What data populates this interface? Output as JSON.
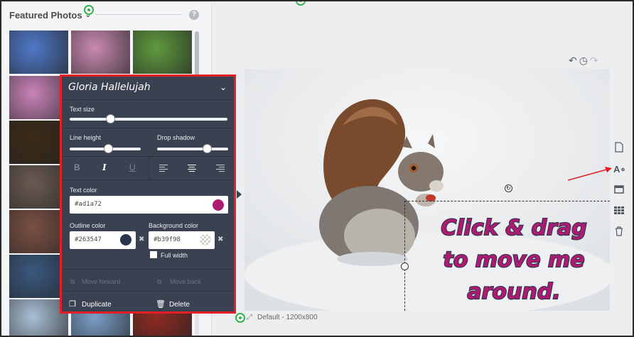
{
  "sidebar": {
    "title": "Featured Photos",
    "help_icon": "?",
    "photos": [
      {
        "name": "blue-hydrangea",
        "color": "#4f79c9"
      },
      {
        "name": "pink-blossoms",
        "color": "#c98ab0"
      },
      {
        "name": "green-grass",
        "color": "#5f9a3e"
      },
      {
        "name": "pink-tree",
        "color": "#c983b9"
      },
      {
        "name": "sparkler",
        "color": "#3b2a16"
      },
      {
        "name": "coffee-cup",
        "color": "#6b5a52"
      },
      {
        "name": "woman-portrait",
        "color": "#7a5043"
      },
      {
        "name": "winter-girl",
        "color": "#39587e"
      },
      {
        "name": "snowy-mountain",
        "color": "#a9bfd6"
      },
      {
        "name": "snow-crystals",
        "color": "#7a9ec8"
      },
      {
        "name": "red-ornaments",
        "color": "#8e2a22"
      }
    ]
  },
  "text_panel": {
    "font_name": "Gloria Hallelujah",
    "text_size_label": "Text size",
    "text_size_value": 0.27,
    "line_height_label": "Line height",
    "line_height_value": 0.55,
    "drop_shadow_label": "Drop shadow",
    "drop_shadow_value": 0.7,
    "format_buttons": [
      "B",
      "I",
      "U"
    ],
    "text_color_label": "Text color",
    "text_color": "#ad1a72",
    "outline_color_label": "Outline color",
    "outline_color": "#263547",
    "background_color_label": "Background color",
    "background_color": "#b39f98",
    "full_width_label": "Full width",
    "move_forward_label": "Move forward",
    "move_back_label": "Move back",
    "duplicate_label": "Duplicate",
    "delete_label": "Delete"
  },
  "canvas": {
    "caption": "Default - 1200x800",
    "overlay_lines": [
      "Click & drag",
      "to move me",
      "around."
    ],
    "accent_red": "#e31e24",
    "green_marker": "#33b14a"
  },
  "tools": [
    "page-icon",
    "text-style-icon",
    "layout-icon",
    "grid-icon",
    "trash-icon"
  ]
}
